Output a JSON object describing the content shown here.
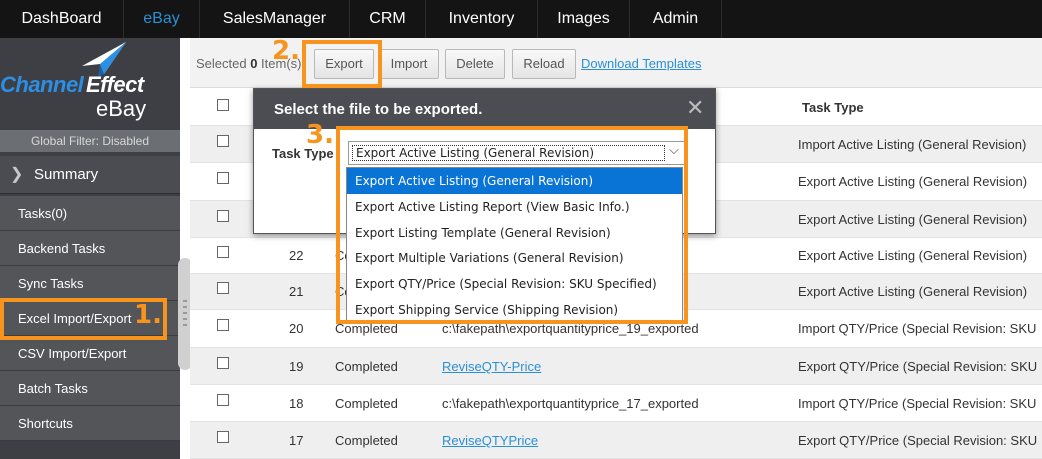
{
  "nav": {
    "items": [
      {
        "label": "DashBoard",
        "active": false
      },
      {
        "label": "eBay",
        "active": true
      },
      {
        "label": "SalesManager",
        "active": false
      },
      {
        "label": "CRM",
        "active": false
      },
      {
        "label": "Inventory",
        "active": false
      },
      {
        "label": "Images",
        "active": false
      },
      {
        "label": "Admin",
        "active": false
      }
    ]
  },
  "sidebar": {
    "logo": {
      "channel": "Channel",
      "effect": "Effect",
      "ebay": "eBay"
    },
    "global_filter": "Global Filter: Disabled",
    "summary": "Summary",
    "items": [
      {
        "label": "Tasks(0)"
      },
      {
        "label": "Backend Tasks"
      },
      {
        "label": "Sync Tasks"
      },
      {
        "label": "Excel Import/Export"
      },
      {
        "label": "CSV Import/Export"
      },
      {
        "label": "Batch Tasks"
      },
      {
        "label": "Shortcuts"
      }
    ]
  },
  "toolbar": {
    "selected_prefix": "Selected ",
    "selected_count": "0",
    "selected_suffix": " Item(s)",
    "export_label": "Export",
    "import_label": "Import",
    "delete_label": "Delete",
    "reload_label": "Reload",
    "download_label": "Download Templates"
  },
  "annotations": {
    "step1": "1.",
    "step2": "2.",
    "step3": "3."
  },
  "table": {
    "header_task_type": "Task Type",
    "rows": [
      {
        "id": "",
        "status": "",
        "file": "",
        "file_is_link": false,
        "task_type": "Import Active Listing (General Revision)"
      },
      {
        "id": "",
        "status": "",
        "file": "",
        "file_is_link": false,
        "task_type": "Export Active Listing (General Revision)"
      },
      {
        "id": "",
        "status": "",
        "file": "",
        "file_is_link": false,
        "task_type": "Export Active Listing (General Revision)"
      },
      {
        "id": "22",
        "status": "Co",
        "file": "",
        "file_is_link": false,
        "task_type": "Export Active Listing (General Revision)"
      },
      {
        "id": "21",
        "status": "Co",
        "file": "",
        "file_is_link": false,
        "task_type": "Export Active Listing (General Revision)"
      },
      {
        "id": "20",
        "status": "Completed",
        "file": "c:\\fakepath\\exportquantityprice_19_exported",
        "file_is_link": false,
        "task_type": "Import QTY/Price (Special Revision: SKU"
      },
      {
        "id": "19",
        "status": "Completed",
        "file": "ReviseQTY-Price",
        "file_is_link": true,
        "task_type": "Export QTY/Price (Special Revision: SKU"
      },
      {
        "id": "18",
        "status": "Completed",
        "file": "c:\\fakepath\\exportquantityprice_17_exported",
        "file_is_link": false,
        "task_type": "Import QTY/Price (Special Revision: SKU"
      },
      {
        "id": "17",
        "status": "Completed",
        "file": "ReviseQTYPrice",
        "file_is_link": true,
        "task_type": "Export QTY/Price (Special Revision: SKU"
      }
    ]
  },
  "modal": {
    "title": "Select the file to be exported.",
    "task_type_label": "Task Type",
    "selected_value": "Export Active Listing (General Revision)",
    "options": [
      "Export Active Listing (General Revision)",
      "Export Active Listing Report (View Basic Info.)",
      "Export Listing Template (General Revision)",
      "Export Multiple Variations (General Revision)",
      "Export QTY/Price (Special Revision: SKU Specified)",
      "Export Shipping Service (Shipping Revision)"
    ],
    "highlighted_index": 0
  },
  "colors": {
    "accent": "#2b8fd6",
    "annotation": "#f7941d",
    "selected_option": "#0a74d6"
  }
}
